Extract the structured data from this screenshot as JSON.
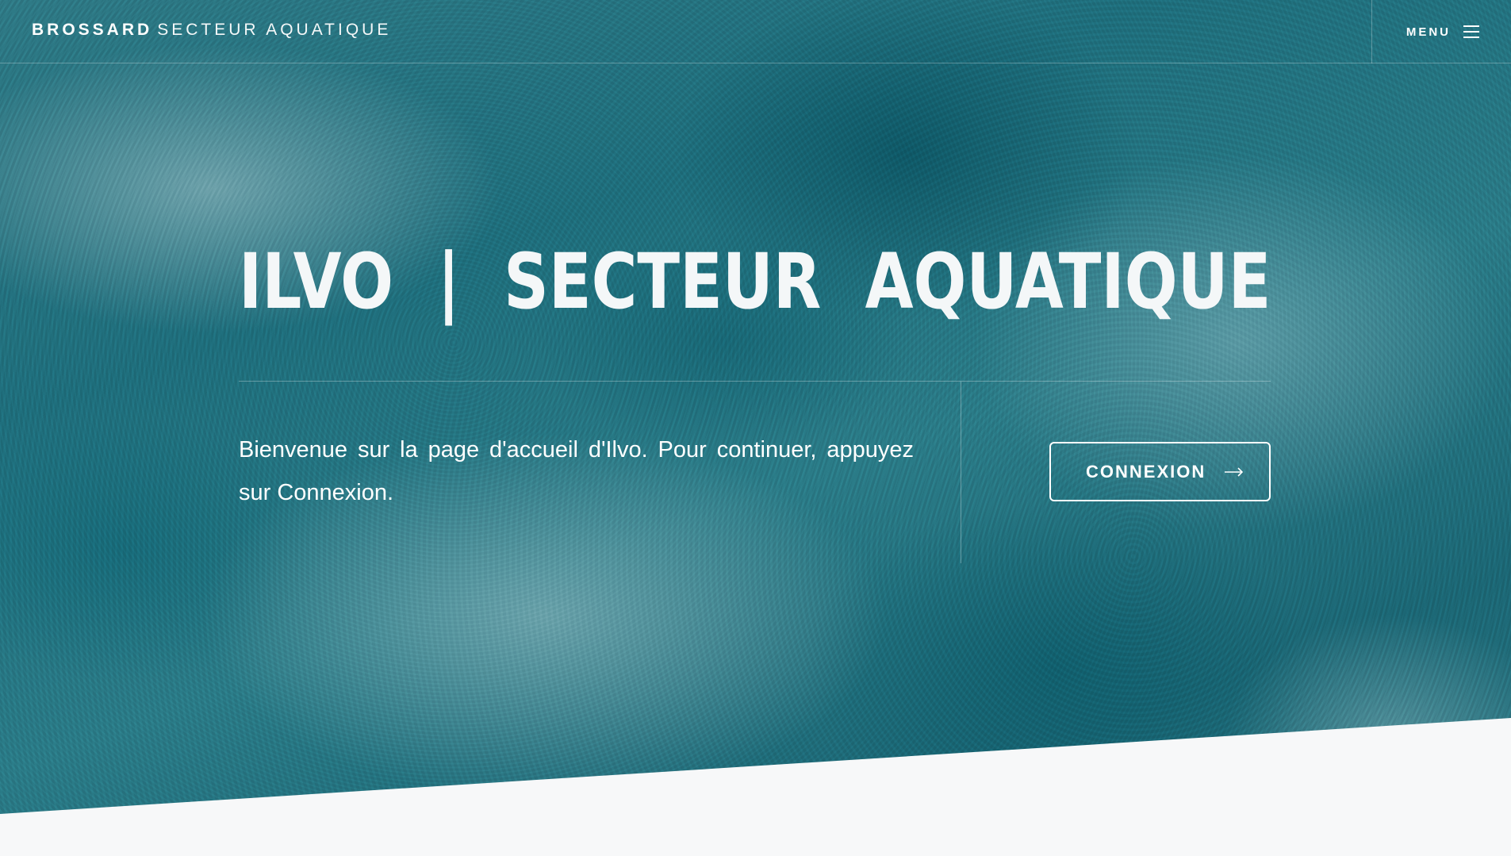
{
  "header": {
    "brand_strong": "BROSSARD",
    "brand_light": "SECTEUR AQUATIQUE",
    "menu_label": "MENU",
    "menu_icon": "hamburger-icon"
  },
  "hero": {
    "title_words": [
      "ILVO",
      "|",
      "SECTEUR",
      "AQUATIQUE"
    ],
    "intro_text": "Bienvenue sur la page d'accueil d'Ilvo. Pour continuer, appuyez sur Connexion.",
    "cta_label": "CONNEXION",
    "cta_icon": "arrow-right-icon"
  },
  "colors": {
    "ocean_teal": "#1f6f7d",
    "text_white": "#ffffff",
    "page_background": "#f7f8f9"
  }
}
